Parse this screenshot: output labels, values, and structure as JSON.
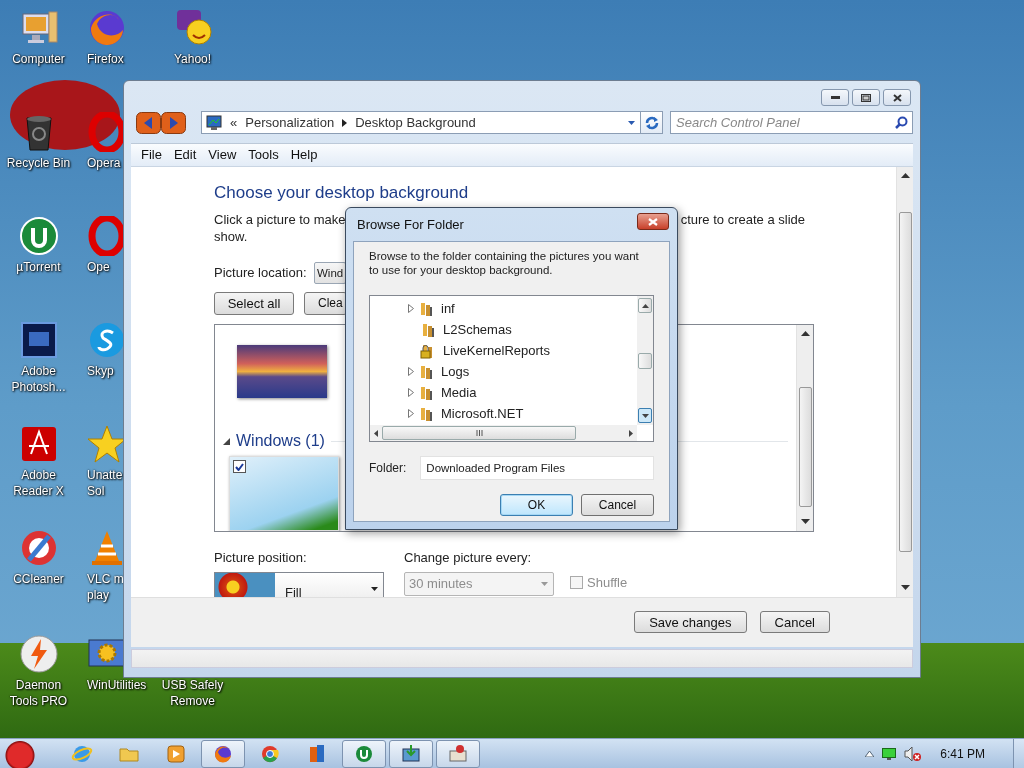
{
  "desktop": {
    "columns": [
      [
        {
          "label": [
            "Computer"
          ],
          "kind": "computer"
        },
        {
          "label": [
            "Recycle Bin"
          ],
          "kind": "bin"
        },
        {
          "label": [
            "µTorrent"
          ],
          "kind": "torrent"
        },
        {
          "label": [
            "Adobe",
            "Photosh..."
          ],
          "kind": "photoshop"
        },
        {
          "label": [
            "Adobe",
            "Reader X"
          ],
          "kind": "reader"
        },
        {
          "label": [
            "CCleaner"
          ],
          "kind": "ccleaner"
        },
        {
          "label": [
            "Daemon",
            "Tools PRO"
          ],
          "kind": "daemon"
        }
      ],
      [
        {
          "label": [
            "Firefox"
          ],
          "kind": "firefox"
        },
        {
          "label": [
            "Opera"
          ],
          "kind": "opera"
        },
        {
          "label": [
            "Ope"
          ],
          "kind": "opera"
        },
        {
          "label": [
            "Skyp"
          ],
          "kind": "skype"
        },
        {
          "label": [
            "Unatte",
            "Sol"
          ],
          "kind": "star"
        },
        {
          "label": [
            "VLC m",
            "play"
          ],
          "kind": "vlc"
        },
        {
          "label": [
            "WinUtilities"
          ],
          "kind": "winutil"
        }
      ],
      [
        {
          "label": [
            "Yahoo!"
          ],
          "kind": "yahoo"
        },
        {
          "label": [
            "USB Safely",
            "Remove"
          ],
          "kind": "usb"
        }
      ]
    ]
  },
  "window": {
    "address": {
      "prefix": "«",
      "crumbs": [
        "Personalization",
        "Desktop Background"
      ]
    },
    "search": {
      "placeholder": "Search Control Panel"
    },
    "menu": [
      "File",
      "Edit",
      "View",
      "Tools",
      "Help"
    ],
    "heading": "Choose your desktop background",
    "description": [
      "Click a picture to make",
      "cture to create a slide",
      "show."
    ],
    "picture_location": {
      "label": "Picture location:",
      "value": "Wind"
    },
    "buttons": [
      "Select all",
      "Clea"
    ],
    "picture_list": {
      "items": [
        {
          "kind": "thumbnail",
          "checked": false
        },
        {
          "kind": "group",
          "label": "Windows (1)",
          "expanded": true
        },
        {
          "kind": "thumbnail",
          "checked": true
        }
      ]
    },
    "picture_position": {
      "label": "Picture position:",
      "value": "Fill"
    },
    "change_picture": {
      "label": "Change picture every:",
      "value": "30 minutes",
      "disabled": true
    },
    "shuffle": {
      "label": "Shuffle",
      "checked": false,
      "disabled": true
    },
    "footer_buttons": [
      "Save changes",
      "Cancel"
    ]
  },
  "dialog": {
    "title": "Browse For Folder",
    "instructions": "Browse to the folder containing the pictures you want to use for your desktop background.",
    "tree": [
      {
        "label": "inf",
        "expandable": true,
        "locked": false
      },
      {
        "label": "L2Schemas",
        "expandable": false,
        "locked": false
      },
      {
        "label": "LiveKernelReports",
        "expandable": false,
        "locked": true
      },
      {
        "label": "Logs",
        "expandable": true,
        "locked": false
      },
      {
        "label": "Media",
        "expandable": true,
        "locked": false
      },
      {
        "label": "Microsoft.NET",
        "expandable": true,
        "locked": false
      }
    ],
    "folder": {
      "label": "Folder:",
      "value": "Downloaded Program Files"
    },
    "buttons": [
      {
        "label": "OK",
        "default": true
      },
      {
        "label": "Cancel",
        "default": false
      }
    ]
  },
  "taskbar": {
    "items": [
      {
        "kind": "ie",
        "open": false
      },
      {
        "kind": "folder",
        "open": false
      },
      {
        "kind": "media",
        "open": false
      },
      {
        "kind": "firefox",
        "open": true
      },
      {
        "kind": "chrome",
        "open": false
      },
      {
        "kind": "office",
        "open": false
      },
      {
        "kind": "torrent",
        "open": true
      },
      {
        "kind": "install",
        "open": true
      },
      {
        "kind": "paint",
        "open": true
      }
    ],
    "volume_muted": true,
    "clock": "6:41 PM"
  }
}
